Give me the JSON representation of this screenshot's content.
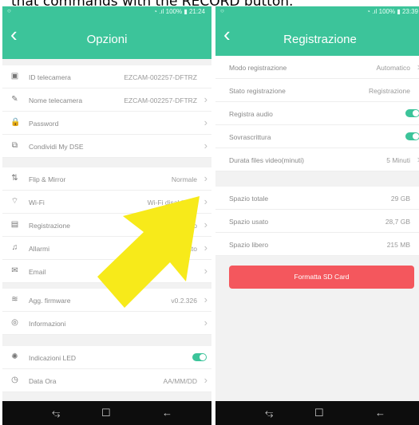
{
  "caption": "that commands with the RECORD button.",
  "left": {
    "status": {
      "time": "21:24",
      "battery": "100%"
    },
    "title": "Opzioni",
    "sec1": [
      {
        "icon": "id-card-icon",
        "glyph": "▣",
        "label": "ID telecamera",
        "value": "EZCAM-002257-DFTRZ",
        "chevron": false
      },
      {
        "icon": "edit-icon",
        "glyph": "✎",
        "label": "Nome telecamera",
        "value": "EZCAM-002257-DFTRZ",
        "chevron": true
      },
      {
        "icon": "lock-icon",
        "glyph": "🔒",
        "label": "Password",
        "value": "",
        "chevron": true
      },
      {
        "icon": "share-icon",
        "glyph": "⧉",
        "label": "Condividi My DSE",
        "value": "",
        "chevron": true
      }
    ],
    "sec2": [
      {
        "icon": "flip-icon",
        "glyph": "⇅",
        "label": "Flip & Mirror",
        "value": "Normale",
        "chevron": true
      },
      {
        "icon": "wifi-icon",
        "glyph": "⌔",
        "label": "Wi-Fi",
        "value": "Wi-Fi disabilitato",
        "chevron": true
      },
      {
        "icon": "calendar-icon",
        "glyph": "▤",
        "label": "Registrazione",
        "value": "...natico",
        "chevron": true
      },
      {
        "icon": "alarm-icon",
        "glyph": "♫",
        "label": "Allarmi",
        "value": "...litato",
        "chevron": true
      },
      {
        "icon": "mail-icon",
        "glyph": "✉",
        "label": "Email",
        "value": "",
        "chevron": true
      }
    ],
    "sec3": [
      {
        "icon": "layers-icon",
        "glyph": "≋",
        "label": "Agg. firmware",
        "value": "v0.2.326",
        "chevron": true
      },
      {
        "icon": "info-icon",
        "glyph": "◎",
        "label": "Informazioni",
        "value": "",
        "chevron": true
      }
    ],
    "sec4": [
      {
        "icon": "led-icon",
        "glyph": "✺",
        "label": "Indicazioni LED",
        "toggle": true
      },
      {
        "icon": "clock-icon",
        "glyph": "◷",
        "label": "Data Ora",
        "value": "AA/MM/DD",
        "chevron": true
      }
    ]
  },
  "right": {
    "status": {
      "time": "23:39",
      "battery": "100%"
    },
    "title": "Registrazione",
    "sec1": [
      {
        "label": "Modo registrazione",
        "value": "Automatico",
        "chevron": true
      },
      {
        "label": "Stato registrazione",
        "value": "Registrazione",
        "chevron": false
      },
      {
        "label": "Registra audio",
        "toggle": true
      },
      {
        "label": "Sovrascrittura",
        "toggle": true
      },
      {
        "label": "Durata files video(minuti)",
        "value": "5 Minuti",
        "chevron": true
      }
    ],
    "sec2": [
      {
        "label": "Spazio totale",
        "value": "29 GB"
      },
      {
        "label": "Spazio usato",
        "value": "28,7 GB"
      },
      {
        "label": "Spazio libero",
        "value": "215 MB"
      }
    ],
    "format_button": "Formatta SD Card"
  },
  "nav": {
    "recent": "⥃",
    "home": "☐",
    "back": "←"
  },
  "colors": {
    "accent": "#3cc49a",
    "danger": "#f4575d",
    "arrow": "#f7ea1a"
  }
}
